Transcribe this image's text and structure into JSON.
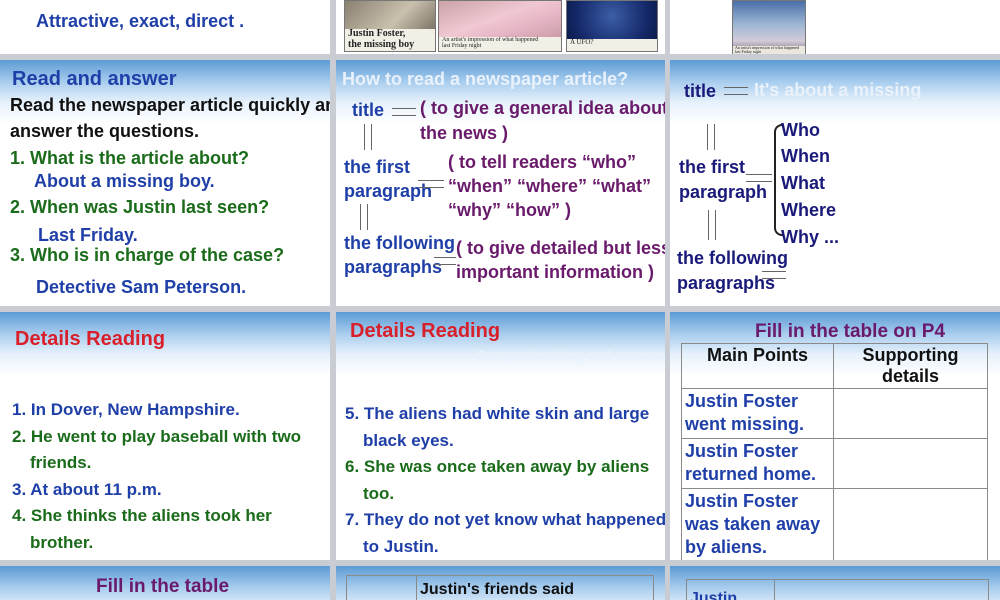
{
  "slide_top_left": {
    "text": "Attractive, exact, direct ."
  },
  "slide_top_mid": {
    "photo1_caption": "Justin Foster,\nthe missing boy",
    "photo2_caption": "An artist's impression of what happened\nlast Friday night",
    "photo3_caption": "A UFO?"
  },
  "slide_top_right": {
    "caption": "An artist's impression of what happened\nlast Friday night"
  },
  "read_answer": {
    "title": "Read and answer",
    "intro1": "Read the newspaper article quickly and",
    "intro2": "answer the questions.",
    "q1": "1. What is the article about?",
    "a1": "About a missing boy.",
    "q2": "2. When was Justin last seen?",
    "a2": "Last Friday.",
    "q3": "3. Who is in charge of the case?",
    "a3": "Detective Sam Peterson."
  },
  "how_to_read": {
    "title": "How to read a newspaper article?",
    "title_label": "title",
    "title_desc1": "( to give a general idea about",
    "title_desc2": "the news )",
    "first_label1": "the first",
    "first_label2": "paragraph",
    "first_desc1": "( to tell readers “who”",
    "first_desc2": "“when” “where” “what”",
    "first_desc3": "“why” “how” )",
    "following_label1": "the following",
    "following_label2": "paragraphs",
    "following_desc1": "( to give detailed but less",
    "following_desc2": "important information )"
  },
  "structure": {
    "title_label": "title",
    "title_faint": "It's about a missing",
    "first_label1": "the first",
    "first_label2": "paragraph",
    "w1": "Who",
    "w2": "When",
    "w3": "What",
    "w4": "Where",
    "w5": "Why ...",
    "following_label1": "the following",
    "following_label2": "paragraphs"
  },
  "details1": {
    "title": "Details Reading",
    "l1": "1. In Dover, New Hampshire.",
    "l2a": "2. He went to play baseball with two",
    "l2b": "friends.",
    "l3": "3. At about 11 p.m.",
    "l4a": "4. She thinks the aliens took her",
    "l4b": "brother."
  },
  "details2": {
    "title": "Details Reading",
    "faint": "Comprehending and answering",
    "l5a": "5. The aliens had white skin and large",
    "l5b": "black eyes.",
    "l6a": "6. She was once taken away by aliens",
    "l6b": "too.",
    "l7a": "7. They do not yet know what happened",
    "l7b": "to Justin."
  },
  "fill_p4": {
    "title": "Fill in the table on P4",
    "headers": [
      "Main Points",
      "Supporting details"
    ],
    "rows": [
      "Justin Foster went missing.",
      "Justin Foster returned home.",
      "Justin Foster was taken away by aliens."
    ]
  },
  "bottom": {
    "left_title": "Fill in the table",
    "mid_header": "Justin's friends said",
    "right_cell": "Justin"
  }
}
